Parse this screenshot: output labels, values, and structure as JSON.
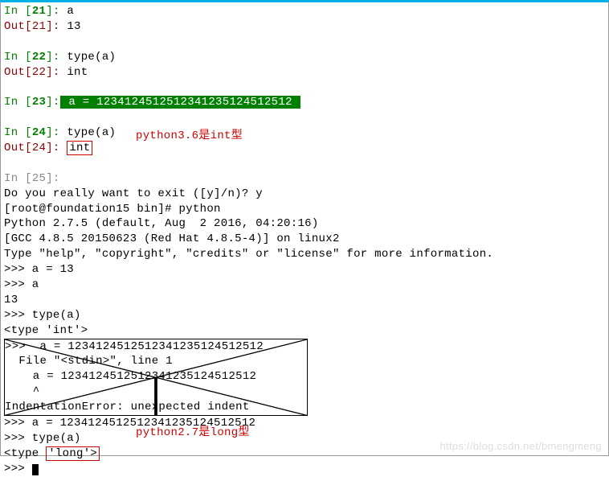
{
  "cells": {
    "c21": {
      "in_label": "In ",
      "in_num": "21",
      "in_code": "a",
      "out_label": "Out",
      "out_num": "21",
      "out_val": "13"
    },
    "c22": {
      "in_label": "In ",
      "in_num": "22",
      "in_code": "type(a)",
      "out_label": "Out",
      "out_num": "22",
      "out_val": "int"
    },
    "c23": {
      "in_label": "In ",
      "in_num": "23",
      "in_code_hl": " a = 123412451251234123512​4512512 "
    },
    "c24": {
      "in_label": "In ",
      "in_num": "24",
      "in_code": "type(a)",
      "out_label": "Out",
      "out_num": "24",
      "out_val": "int"
    },
    "c25": {
      "in_label": "In ",
      "in_num": "25"
    }
  },
  "annotation1": "python3.6是int型",
  "annotation2": "python2.7是long型",
  "terminal": {
    "exit_prompt": "Do you really want to exit ([y]/n)? y",
    "shell_prompt": "[root@foundation15 bin]# python",
    "py_ver": "Python 2.7.5 (default, Aug  2 2016, 04:20:16)",
    "gcc": "[GCC 4.8.5 20150623 (Red Hat 4.8.5-4)] on linux2",
    "help": "Type \"help\", \"copyright\", \"credits\" or \"license\" for more information.",
    "l1": ">>> a = 13",
    "l2": ">>> a",
    "l3": "13",
    "l4": ">>> type(a)",
    "l5": "<type 'int'>",
    "crossed": {
      "l1": ">>>  a = 123412451251234123512​4512512",
      "l2": "  File \"<stdin>\", line 1",
      "l3": "    a = 123412451251234123512​4512512",
      "l4": "    ^",
      "l5": "IndentationError: unexpected indent"
    },
    "l6": ">>> a = 123412451251234123512​4512512",
    "l7": ">>> type(a)",
    "l8a": "<type ",
    "l8b": "'long'>",
    "l9": ">>> "
  },
  "watermark": "https://blog.csdn.net/bmengmeng"
}
